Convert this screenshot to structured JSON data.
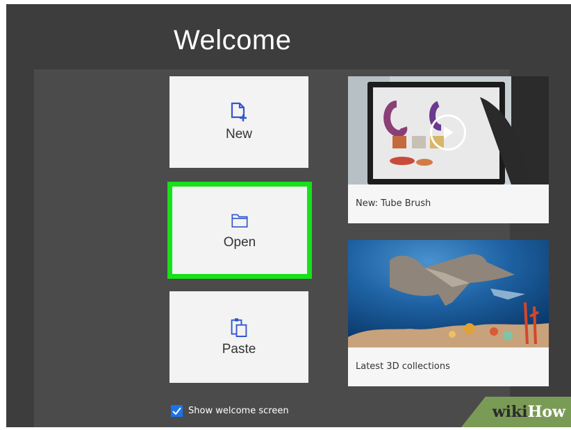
{
  "title": "Welcome",
  "tiles": {
    "new": {
      "label": "New",
      "icon": "new-file-icon"
    },
    "open": {
      "label": "Open",
      "icon": "folder-icon",
      "highlight_color": "#18e01a"
    },
    "paste": {
      "label": "Paste",
      "icon": "paste-icon"
    }
  },
  "cards": [
    {
      "caption": "New: Tube Brush",
      "icon": "play-icon"
    },
    {
      "caption": "Latest 3D collections"
    }
  ],
  "show_welcome": {
    "label": "Show welcome screen",
    "checked": true
  },
  "watermark": {
    "wiki": "wiki",
    "how": "How"
  },
  "colors": {
    "accent": "#1a73e8",
    "icon": "#3355cc",
    "background": "#3d3d3d"
  }
}
